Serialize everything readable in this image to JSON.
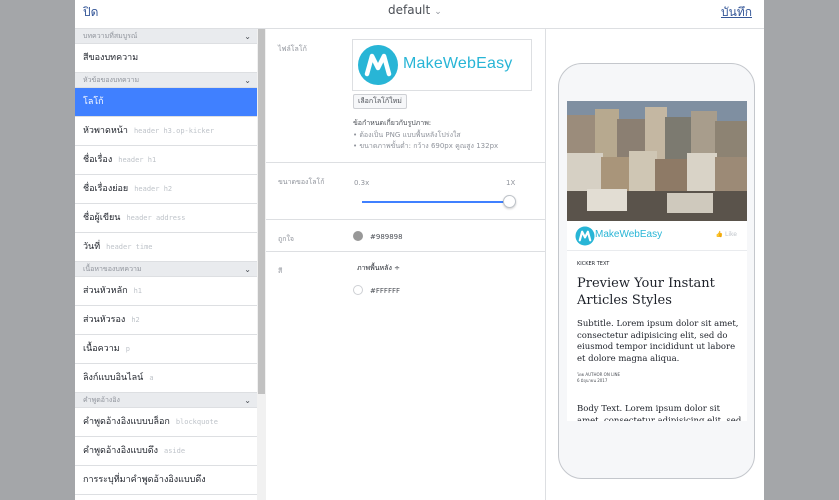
{
  "header": {
    "close_label": "ปิด",
    "preset_label": "default",
    "save_label": "บันทึก"
  },
  "nav": {
    "sections": [
      {
        "title": "บทความที่สมบูรณ์",
        "items": [
          {
            "label": "สีของบทความ",
            "tag": ""
          }
        ]
      },
      {
        "title": "หัวข้อของบทความ",
        "items": [
          {
            "label": "โลโก้",
            "tag": ""
          },
          {
            "label": "หัวพาดหน้า",
            "tag": "header h3.op-kicker"
          },
          {
            "label": "ชื่อเรื่อง",
            "tag": "header h1"
          },
          {
            "label": "ชื่อเรื่องย่อย",
            "tag": "header h2"
          },
          {
            "label": "ชื่อผู้เขียน",
            "tag": "header address"
          },
          {
            "label": "วันที่",
            "tag": "header time"
          }
        ]
      },
      {
        "title": "เนื้อหาของบทความ",
        "items": [
          {
            "label": "ส่วนหัวหลัก",
            "tag": "h1"
          },
          {
            "label": "ส่วนหัวรอง",
            "tag": "h2"
          },
          {
            "label": "เนื้อความ",
            "tag": "p"
          },
          {
            "label": "ลิงก์แบบอินไลน์",
            "tag": "a"
          }
        ]
      },
      {
        "title": "คำพูดอ้างอิง",
        "items": [
          {
            "label": "คำพูดอ้างอิงแบบบล็อก",
            "tag": "blockquote"
          },
          {
            "label": "คำพูดอ้างอิงแบบดึง",
            "tag": "aside"
          },
          {
            "label": "การระบุที่มาคำพูดอ้างอิงแบบดึง",
            "tag": ""
          }
        ]
      }
    ]
  },
  "settings": {
    "logo_label": "ไฟล์โลโก้",
    "logo_text": "MakeWebEasy",
    "new_logo_button": "เลือกโลโก้ใหม่",
    "requirements_title": "ข้อกำหนดเกี่ยวกับรูปภาพ:",
    "requirements": [
      "ต้องเป็น PNG แบบพื้นหลังโปร่งใส",
      "ขนาดภาพขั้นต่ำ: กว้าง 690px คูณสูง 132px"
    ],
    "size_label": "ขนาดของโลโก้",
    "size_min": "0.3x",
    "size_max": "1X",
    "size_value": 1,
    "accent_label": "ถูกใจ",
    "accent_hex": "#989898",
    "color_label": "สี",
    "background_type": "ภาพพื้นหลัง ÷",
    "color_hex": "#FFFFFF"
  },
  "preview": {
    "logo_text": "MakeWebEasy",
    "like_label": "Like",
    "kicker": "KICKER TEXT",
    "title": "Preview Your Instant Articles Styles",
    "subtitle": "Subtitle. Lorem ipsum dolor sit amet, consectetur adipisicing elit, sed do eiusmod tempor incididunt ut labore et dolore magna aliqua.",
    "byline": "โดย AUTHOR ON LINE",
    "date": "6 มิถุนายน 2017",
    "body": "Body Text. Lorem ipsum dolor sit amet, consectetur adipisicing elit, sed do eiusmod"
  },
  "colors": {
    "accent": "#4080ff",
    "logo": "#28b5d6"
  }
}
